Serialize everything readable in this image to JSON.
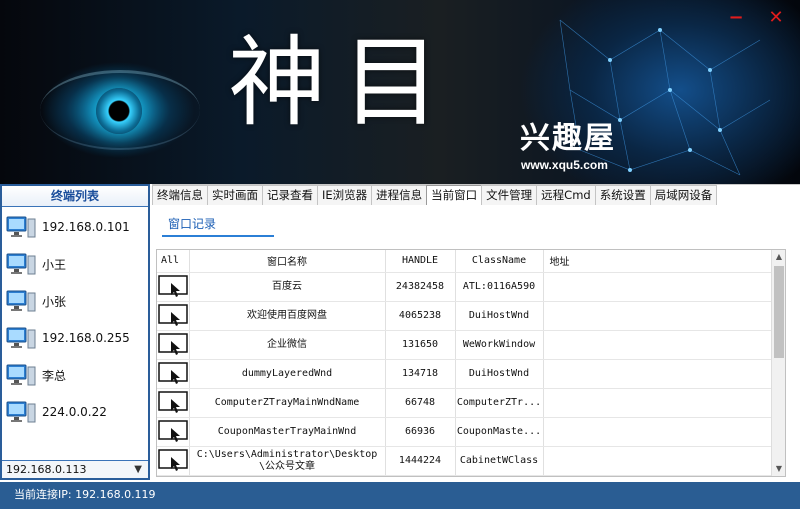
{
  "banner": {
    "title": "神目",
    "brand": "兴趣屋",
    "brand_url": "www.xqu5.com"
  },
  "window_controls": {
    "minimize": "−",
    "close": "✕"
  },
  "terminal_list": {
    "header": "终端列表",
    "items": [
      {
        "label": "192.168.0.101",
        "icon": "computer-icon"
      },
      {
        "label": "小王",
        "icon": "computer-icon"
      },
      {
        "label": "小张",
        "icon": "computer-icon"
      },
      {
        "label": "192.168.0.255",
        "icon": "computer-icon"
      },
      {
        "label": "李总",
        "icon": "computer-icon"
      },
      {
        "label": "224.0.0.22",
        "icon": "computer-icon"
      }
    ],
    "selected_ip": "192.168.0.113"
  },
  "tabs": [
    {
      "label": "终端信息"
    },
    {
      "label": "实时画面"
    },
    {
      "label": "记录查看"
    },
    {
      "label": "IE浏览器"
    },
    {
      "label": "进程信息"
    },
    {
      "label": "当前窗口",
      "active": true
    },
    {
      "label": "文件管理"
    },
    {
      "label": "远程Cmd"
    },
    {
      "label": "系统设置"
    },
    {
      "label": "局域网设备"
    }
  ],
  "subtab": {
    "label": "窗口记录"
  },
  "table": {
    "headers": {
      "all": "All",
      "name": "窗口名称",
      "handle": "HANDLE",
      "class": "ClassName",
      "address": "地址"
    },
    "rows": [
      {
        "name": "百度云",
        "handle": "24382458",
        "class": "ATL:0116A590",
        "address": ""
      },
      {
        "name": "欢迎使用百度网盘",
        "handle": "4065238",
        "class": "DuiHostWnd",
        "address": ""
      },
      {
        "name": "企业微信",
        "handle": "131650",
        "class": "WeWorkWindow",
        "address": ""
      },
      {
        "name": "dummyLayeredWnd",
        "handle": "134718",
        "class": "DuiHostWnd",
        "address": ""
      },
      {
        "name": "ComputerZTrayMainWndName",
        "handle": "66748",
        "class": "ComputerZTr...",
        "address": ""
      },
      {
        "name": "CouponMasterTrayMainWnd",
        "handle": "66936",
        "class": "CouponMaste...",
        "address": ""
      },
      {
        "name": "C:\\Users\\Administrator\\Desktop\\公众号文章",
        "handle": "1444224",
        "class": "CabinetWClass",
        "address": ""
      }
    ]
  },
  "status": {
    "text": "当前连接IP: 192.168.0.119"
  },
  "colors": {
    "accent": "#2a5d93",
    "tab_underline": "#2b7fd6",
    "close": "#e21c1c"
  }
}
